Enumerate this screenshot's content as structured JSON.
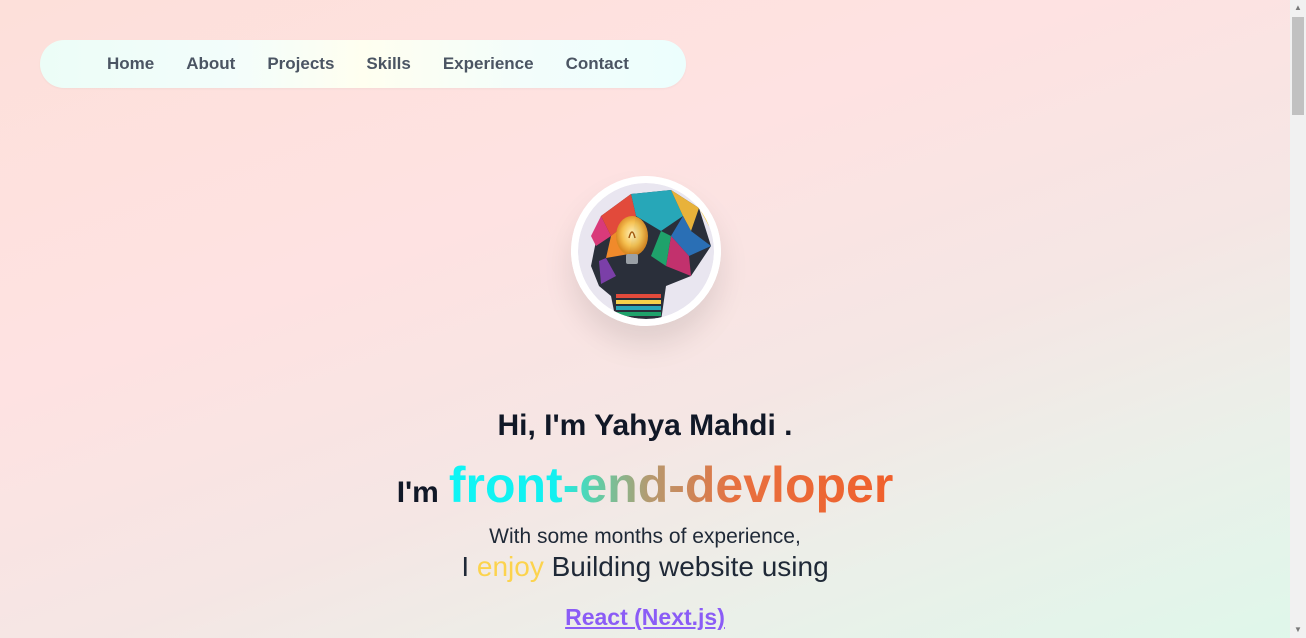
{
  "nav": {
    "items": [
      {
        "label": "Home"
      },
      {
        "label": "About"
      },
      {
        "label": "Projects"
      },
      {
        "label": "Skills"
      },
      {
        "label": "Experience"
      },
      {
        "label": "Contact"
      }
    ]
  },
  "hero": {
    "greeting": "Hi, I'm Yahya Mahdi .",
    "role_prefix": "I'm",
    "role": "front-end-devloper",
    "experience": "With some months of experience,",
    "enjoy_prefix": "I",
    "enjoy_word": "enjoy",
    "enjoy_suffix": "Building website using",
    "tech": "React (Next.js)"
  },
  "avatar": {
    "icon": "lightbulb-head-avatar"
  },
  "colors": {
    "nav_text": "#4b5563",
    "enjoy": "#fcd34d",
    "tech_link": "#8b5cf6",
    "role_gradient_start": "#0ff5f5",
    "role_gradient_end": "#f0602c"
  }
}
